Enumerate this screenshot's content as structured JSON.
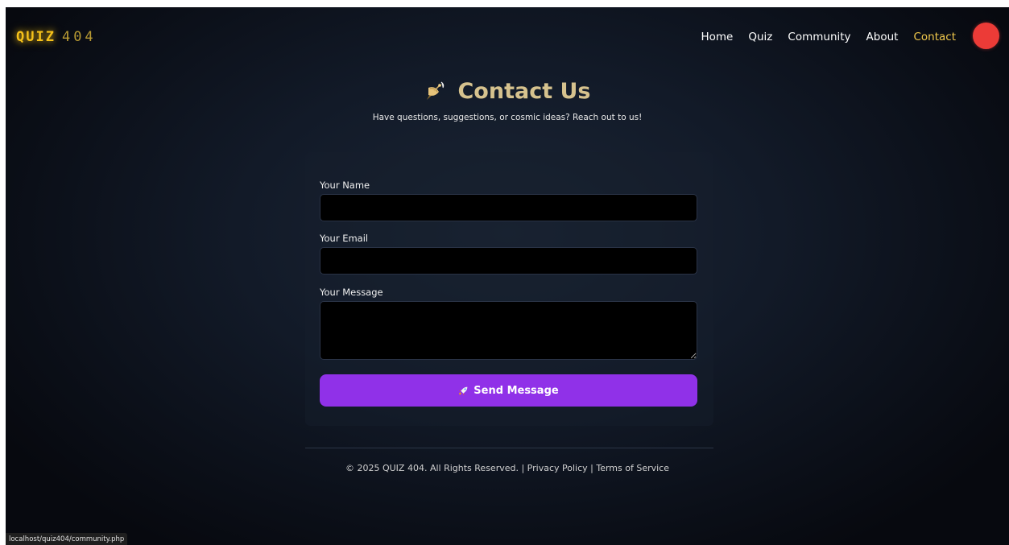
{
  "header": {
    "logo_bold": "QUIZ",
    "logo_thin": "404",
    "nav": [
      {
        "label": "Home"
      },
      {
        "label": "Quiz"
      },
      {
        "label": "Community"
      },
      {
        "label": "About"
      },
      {
        "label": "Contact",
        "active": true
      }
    ]
  },
  "main": {
    "title": "Contact Us",
    "title_icon": "satellite-dish-icon",
    "subtitle": "Have questions, suggestions, or cosmic ideas? Reach out to us!"
  },
  "form": {
    "name_label": "Your Name",
    "name_value": "",
    "email_label": "Your Email",
    "email_value": "",
    "message_label": "Your Message",
    "message_value": "",
    "submit_label": "Send Message",
    "submit_icon": "rocket-icon"
  },
  "footer": {
    "copyright": "© 2025 QUIZ 404. All Rights Reserved. | ",
    "privacy": "Privacy Policy",
    "separator": " | ",
    "terms": "Terms of Service"
  },
  "status_bar": {
    "url": "localhost/quiz404/community.php"
  },
  "colors": {
    "accent": "#9031e8",
    "logo": "#f6c21a",
    "active_nav": "#f2c94c",
    "avatar": "#ec3b37",
    "title": "#d6c28e"
  }
}
